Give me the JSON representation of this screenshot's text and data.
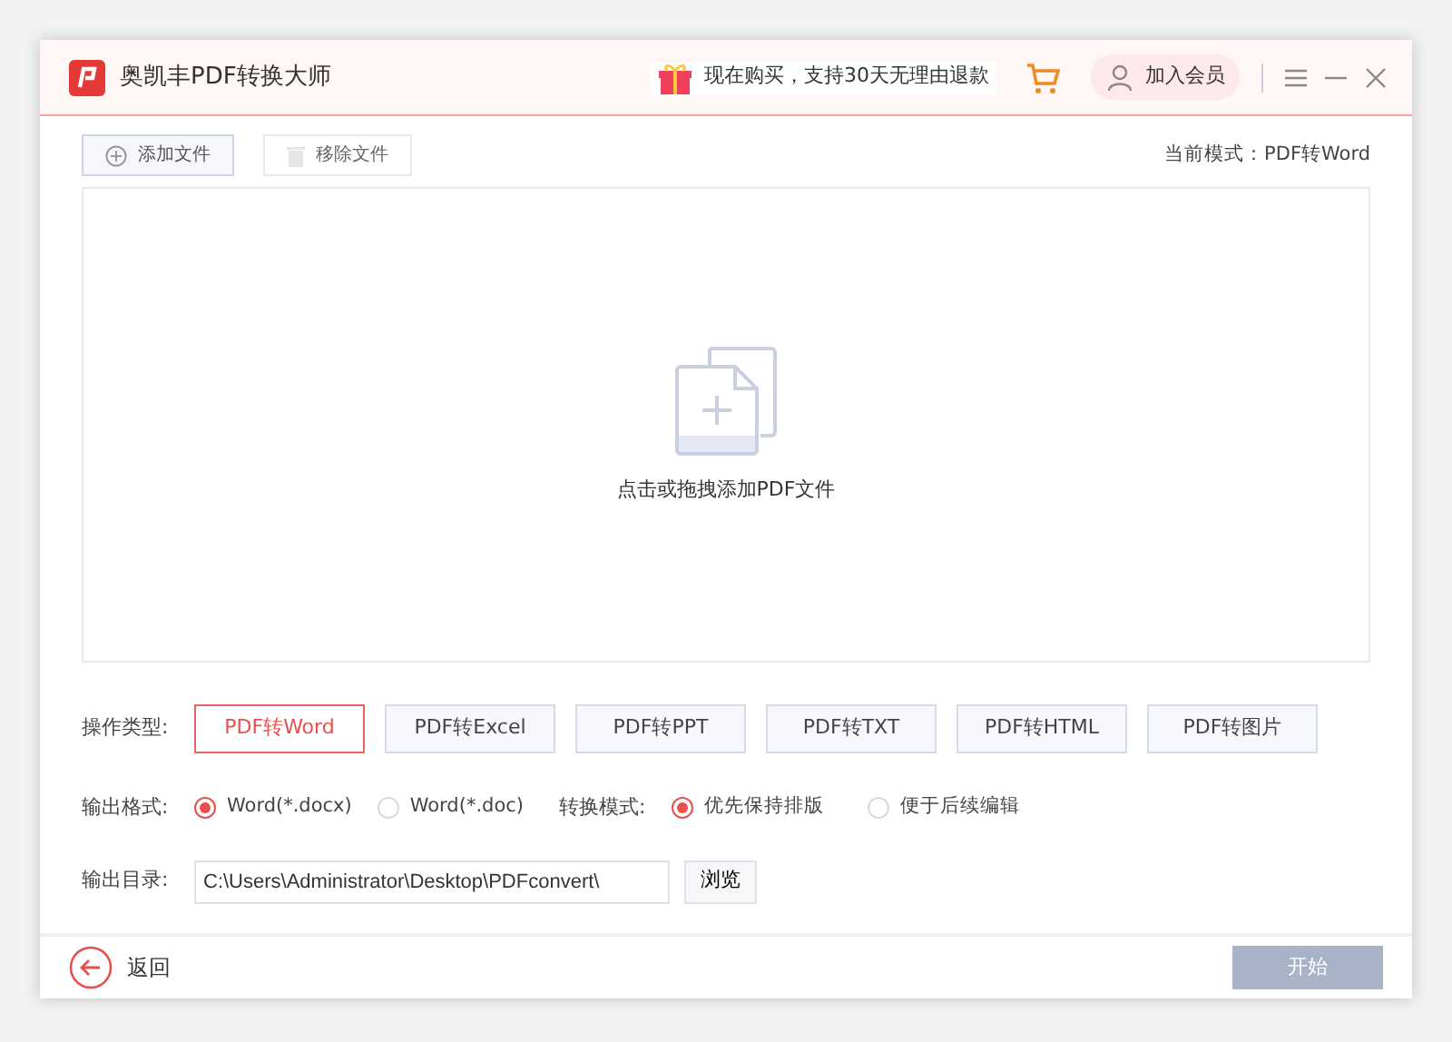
{
  "window": {
    "title": "奥凯丰PDF转换大师"
  },
  "promo": "现在购买，支持30天无理由退款",
  "member": "加入会员",
  "toolbar": [
    {
      "label": "添加文件",
      "kind": "add",
      "disabled": false
    },
    {
      "label": "移除文件",
      "kind": "remove",
      "disabled": true
    }
  ],
  "current_mode": "当前模式：PDF转Word",
  "dropzone": {
    "hint": "点击或拖拽添加PDF文件"
  },
  "operation": {
    "label": "操作类型:",
    "options": [
      {
        "label": "PDF转Word",
        "selected": true
      },
      {
        "label": "PDF转Excel",
        "selected": false
      },
      {
        "label": "PDF转PPT",
        "selected": false
      },
      {
        "label": "PDF转TXT",
        "selected": false
      },
      {
        "label": "PDF转HTML",
        "selected": false
      },
      {
        "label": "PDF转图片",
        "selected": false
      }
    ]
  },
  "output_format": {
    "label": "输出格式:",
    "options": [
      {
        "label": "Word(*.docx)",
        "selected": true
      },
      {
        "label": "Word(*.doc)",
        "selected": false
      }
    ]
  },
  "convert_mode": {
    "label": "转换模式:",
    "options": [
      {
        "label": "优先保持排版",
        "selected": true
      },
      {
        "label": "便于后续编辑",
        "selected": false
      }
    ]
  },
  "output_dir": {
    "label": "输出目录:",
    "value": "C:\\Users\\Administrator\\Desktop\\PDFconvert\\",
    "browse": "浏览"
  },
  "back": "返回",
  "start": {
    "label": "开始",
    "disabled": true
  }
}
